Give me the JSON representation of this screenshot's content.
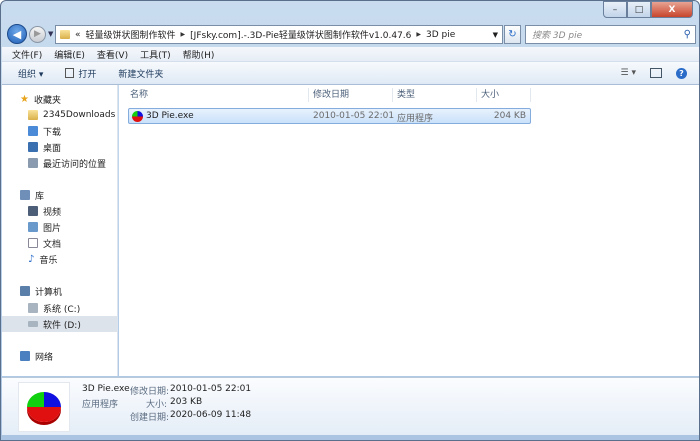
{
  "window": {
    "minimize": "–",
    "maximize": "□",
    "close": "X"
  },
  "address": {
    "overflow": "«",
    "crumbs": [
      "轻量级饼状图制作软件",
      "[JFsky.com].-.3D-Pie轻量级饼状图制作软件v1.0.47.6",
      "3D pie"
    ]
  },
  "search": {
    "placeholder": "搜索 3D pie"
  },
  "menu": [
    "文件(F)",
    "编辑(E)",
    "查看(V)",
    "工具(T)",
    "帮助(H)"
  ],
  "toolbar": {
    "organize": "组织 ▾",
    "open": "打开",
    "new_folder": "新建文件夹"
  },
  "sidebar": {
    "favorites": {
      "label": "收藏夹",
      "items": [
        "2345Downloads",
        "下载",
        "桌面",
        "最近访问的位置"
      ]
    },
    "libraries": {
      "label": "库",
      "items": [
        "视频",
        "图片",
        "文档",
        "音乐"
      ]
    },
    "computer": {
      "label": "计算机",
      "items": [
        "系统 (C:)",
        "软件 (D:)"
      ]
    },
    "network": {
      "label": "网络"
    }
  },
  "columns": [
    "名称",
    "修改日期",
    "类型",
    "大小"
  ],
  "files": [
    {
      "name": "3D Pie.exe",
      "modified": "2010-01-05 22:01",
      "type": "应用程序",
      "size": "204 KB"
    }
  ],
  "details": {
    "name": "3D Pie.exe",
    "type": "应用程序",
    "modified_label": "修改日期:",
    "modified": "2010-01-05 22:01",
    "size_label": "大小:",
    "size": "203 KB",
    "created_label": "创建日期:",
    "created": "2020-06-09 11:48"
  }
}
